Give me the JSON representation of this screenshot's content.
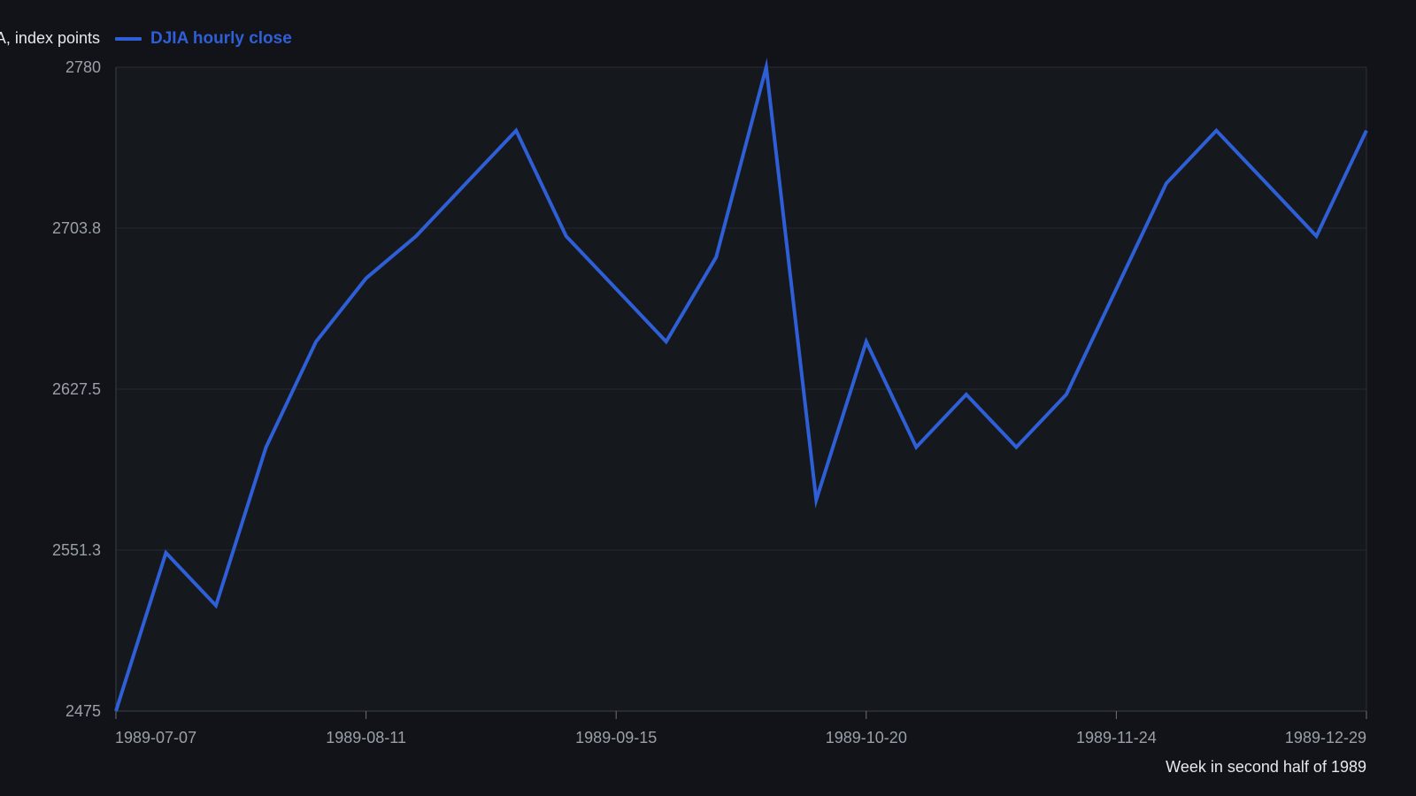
{
  "chart_data": {
    "type": "line",
    "title": "",
    "ylabel": "DJIA, index points",
    "xlabel": "Week in second half of 1989",
    "ylim": [
      2475,
      2780
    ],
    "yticks": [
      "2475",
      "2551.3",
      "2627.5",
      "2703.8",
      "2780"
    ],
    "xticks": [
      "1989-07-07",
      "1989-08-11",
      "1989-09-15",
      "1989-10-20",
      "1989-11-24",
      "1989-12-29"
    ],
    "x": [
      "1989-07-07",
      "1989-07-14",
      "1989-07-21",
      "1989-07-28",
      "1989-08-04",
      "1989-08-11",
      "1989-08-18",
      "1989-08-25",
      "1989-09-01",
      "1989-09-08",
      "1989-09-15",
      "1989-09-22",
      "1989-09-29",
      "1989-10-06",
      "1989-10-13",
      "1989-10-20",
      "1989-10-27",
      "1989-11-03",
      "1989-11-10",
      "1989-11-17",
      "1989-11-24",
      "1989-12-01",
      "1989-12-08",
      "1989-12-15",
      "1989-12-22",
      "1989-12-29"
    ],
    "series": [
      {
        "name": "DJIA hourly close",
        "color": "#2f5fd6",
        "values": [
          2475,
          2550,
          2525,
          2600,
          2650,
          2680,
          2700,
          2725,
          2750,
          2700,
          2675,
          2650,
          2690,
          2780,
          2575,
          2650,
          2600,
          2625,
          2600,
          2625,
          2675,
          2725,
          2750,
          2725,
          2700,
          2750
        ]
      }
    ],
    "grid": true,
    "legend_position": "top-left"
  }
}
